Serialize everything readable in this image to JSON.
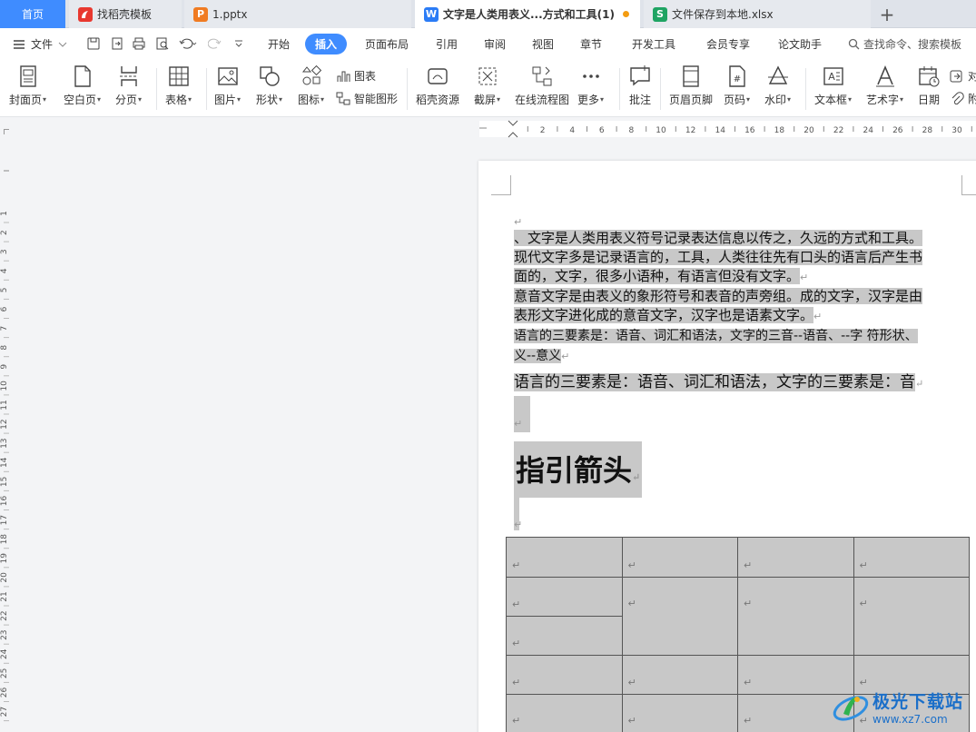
{
  "tabs": [
    {
      "label": "首页"
    },
    {
      "label": "找稻壳模板"
    },
    {
      "label": "1.pptx"
    },
    {
      "label": "文字是人类用表义...方式和工具(1)"
    },
    {
      "label": "文件保存到本地.xlsx"
    }
  ],
  "add_tab": "+",
  "menu": {
    "file": "文件",
    "tabs": [
      "开始",
      "插入",
      "页面布局",
      "引用",
      "审阅",
      "视图",
      "章节",
      "开发工具",
      "会员专享",
      "论文助手"
    ],
    "active_tab": "插入",
    "search": "查找命令、搜索模板"
  },
  "ribbon": {
    "cover": "封面页",
    "blank": "空白页",
    "pagebreak": "分页",
    "table": "表格",
    "picture": "图片",
    "shape": "形状",
    "icon": "图标",
    "chart": "图表",
    "smartart": "智能图形",
    "resource": "稻壳资源",
    "screenshot": "截屏",
    "flowchart": "在线流程图",
    "more": "更多",
    "comment": "批注",
    "header_footer": "页眉页脚",
    "page_number": "页码",
    "watermark": "水印",
    "textbox": "文本框",
    "wordart": "艺术字",
    "date": "日期",
    "object": "对",
    "attach": "附"
  },
  "ruler": {
    "h_ticks": [
      "2",
      "4",
      "6",
      "8",
      "10",
      "12",
      "14",
      "16",
      "18",
      "20",
      "22",
      "24",
      "26",
      "28",
      "30"
    ],
    "v_ticks": [
      "1",
      "2",
      "3",
      "4",
      "5",
      "6",
      "7",
      "8",
      "9",
      "10",
      "11",
      "12",
      "13",
      "14",
      "15",
      "16",
      "17",
      "18",
      "19",
      "20",
      "21",
      "22",
      "23",
      "24",
      "25",
      "26",
      "27"
    ]
  },
  "document": {
    "para_mark": "↵",
    "lines": [
      "、文字是人类用表义符号记录表达信息以传之，久远的方式和工具。",
      "现代文字多是记录语言的，工具，人类往往先有口头的语言后产生书",
      "面的，文字，很多小语种，有语言但没有文字。",
      "意音文字是由表义的象形符号和表音的声旁组。成的文字，汉字是由",
      "表形文字进化成的意音文字，汉字也是语素文字。",
      "语言的三要素是：语音、词汇和语法，文字的三音--语音、--字 符形状、",
      "义--意义"
    ],
    "serif_line": "语言的三要素是：语音、词汇和语法，文字的三要素是：音",
    "heading": "指引箭头"
  },
  "watermark": {
    "name": "极光下载站",
    "url": "www.xz7.com"
  },
  "colors": {
    "accent": "#3f8cff",
    "highlight": "#c8c8c8",
    "unsaved_dot": "#f39c12"
  }
}
